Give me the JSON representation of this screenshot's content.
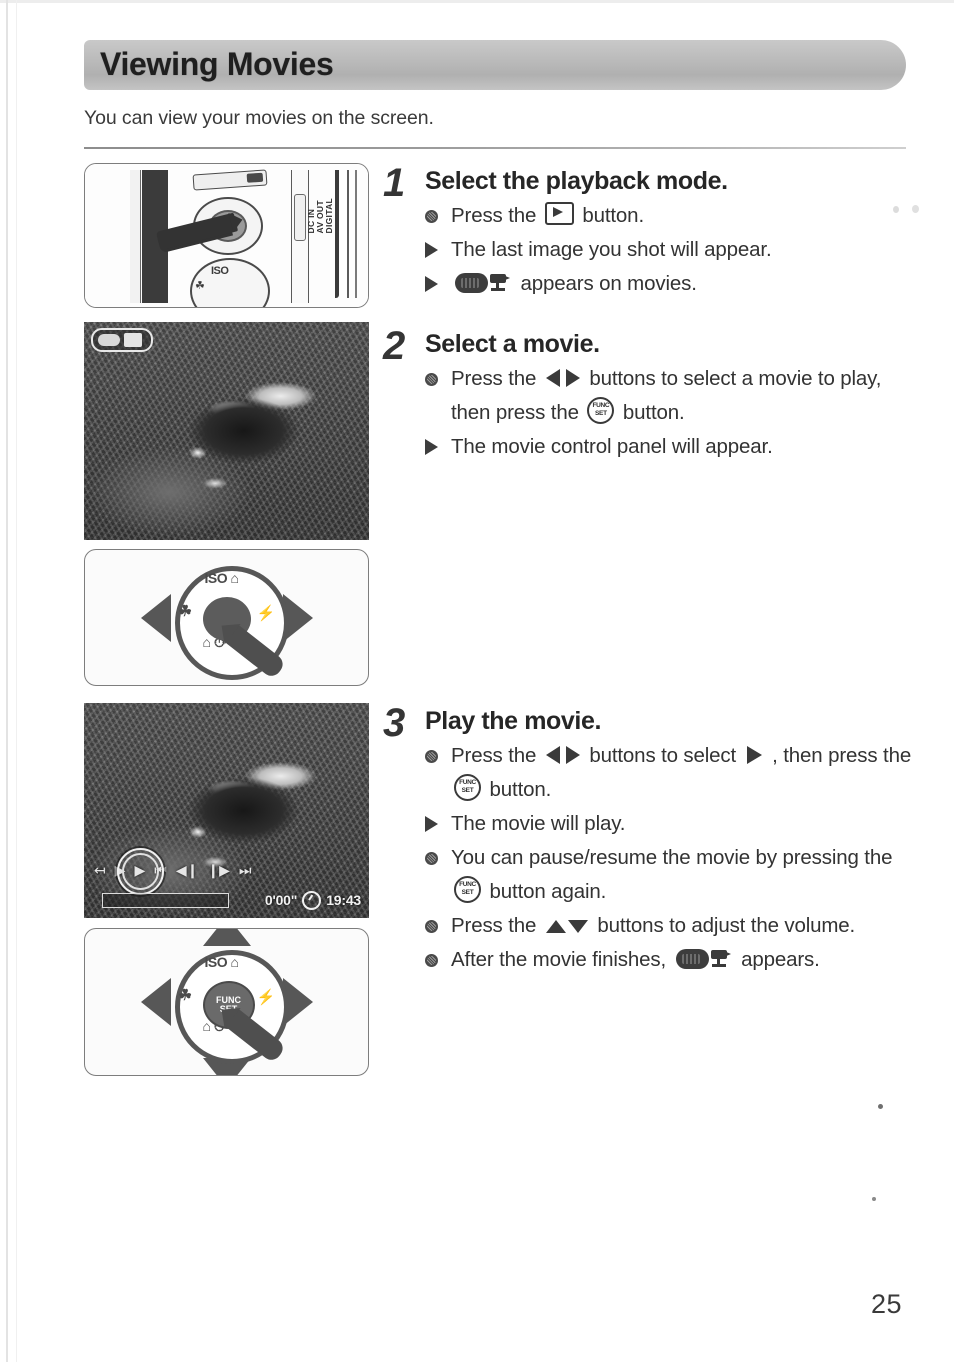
{
  "page": {
    "number": "25",
    "banner_title": "Viewing Movies",
    "intro": "You can view your movies on the screen."
  },
  "steps": [
    {
      "number": "1",
      "heading": "Select the playback mode.",
      "lines": [
        {
          "marker": "dot",
          "parts": [
            {
              "t": "text",
              "v": "Press the "
            },
            {
              "t": "icon",
              "v": "playback-icon"
            },
            {
              "t": "text",
              "v": " button."
            }
          ]
        },
        {
          "marker": "triangle",
          "parts": [
            {
              "t": "text",
              "v": "The last image you shot will appear."
            }
          ]
        },
        {
          "marker": "triangle",
          "parts": [
            {
              "t": "icon",
              "v": "movie-badge-icon"
            },
            {
              "t": "text",
              "v": " appears on movies."
            }
          ]
        }
      ]
    },
    {
      "number": "2",
      "heading": "Select a movie.",
      "lines": [
        {
          "marker": "dot",
          "parts": [
            {
              "t": "text",
              "v": "Press the "
            },
            {
              "t": "icon",
              "v": "left-right-arrows-icon"
            },
            {
              "t": "text",
              "v": " buttons to select a movie to play, then press the "
            },
            {
              "t": "icon",
              "v": "func-set-icon"
            },
            {
              "t": "text",
              "v": " button."
            }
          ]
        },
        {
          "marker": "triangle",
          "parts": [
            {
              "t": "text",
              "v": "The movie control panel will appear."
            }
          ]
        }
      ]
    },
    {
      "number": "3",
      "heading": "Play the movie.",
      "lines": [
        {
          "marker": "dot",
          "parts": [
            {
              "t": "text",
              "v": "Press the "
            },
            {
              "t": "icon",
              "v": "left-right-arrows-icon"
            },
            {
              "t": "text",
              "v": " buttons to select "
            },
            {
              "t": "icon",
              "v": "play-triangle-icon"
            },
            {
              "t": "text",
              "v": " , then press the "
            },
            {
              "t": "icon",
              "v": "func-set-icon"
            },
            {
              "t": "text",
              "v": " button."
            }
          ]
        },
        {
          "marker": "triangle",
          "parts": [
            {
              "t": "text",
              "v": "The movie will play."
            }
          ]
        },
        {
          "marker": "dot",
          "parts": [
            {
              "t": "text",
              "v": "You can pause/resume the movie by pressing the "
            },
            {
              "t": "icon",
              "v": "func-set-icon"
            },
            {
              "t": "text",
              "v": " button again."
            }
          ]
        },
        {
          "marker": "dot",
          "parts": [
            {
              "t": "text",
              "v": "Press the "
            },
            {
              "t": "icon",
              "v": "up-down-arrows-icon"
            },
            {
              "t": "text",
              "v": " buttons to adjust the volume."
            }
          ]
        },
        {
          "marker": "dot",
          "parts": [
            {
              "t": "text",
              "v": "After the movie finishes, "
            },
            {
              "t": "icon",
              "v": "movie-badge-icon"
            },
            {
              "t": "text",
              "v": " appears."
            }
          ]
        }
      ]
    }
  ],
  "illustrations": {
    "camera_back": {
      "port_label": "DC IN\nAV OUT\nDIGITAL",
      "dial_iso_label": "ISO",
      "dial_macro_label": "☘"
    },
    "dial_left_right": {
      "top_label": "ISO ⌂",
      "left_label": "☘",
      "right_label": "⚡",
      "bottom_label": "⌂ ⏱"
    },
    "dial_all_directions": {
      "top_label": "ISO ⌂",
      "left_label": "☘",
      "right_label": "⚡",
      "bottom_label": "⌂ ⏱",
      "center_top": "FUNC",
      "center_bottom": "SET"
    },
    "movie_control_panel": {
      "icons": [
        "exit-icon",
        "play-icon",
        "slow-motion-icon",
        "first-frame-icon",
        "previous-frame-icon",
        "next-frame-icon",
        "last-frame-icon"
      ],
      "elapsed_time": "0'00\"",
      "clock_time": "19:43"
    }
  }
}
